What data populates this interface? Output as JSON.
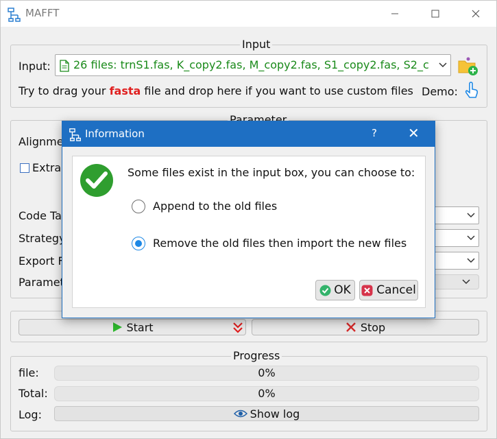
{
  "window": {
    "title": "MAFFT"
  },
  "input_group": {
    "title": "Input",
    "label": "Input:",
    "combo_value": "26 files: trnS1.fas, K_copy2.fas, M_copy2.fas, S1_copy2.fas, S2_c",
    "hint_pre": "Try to drag your",
    "hint_fasta": "fasta",
    "hint_post": "file and drop here if you want to use custom files",
    "demo_label": "Demo:"
  },
  "parameter_group": {
    "title": "Parameter",
    "alignment_label": "Alignme",
    "extract_label": "Extrac",
    "code_table_label": "Code Ta",
    "strategy_label": "Strategy",
    "export_label": "Export F",
    "parameters_label": "Paramet"
  },
  "run": {
    "start_label": "Start",
    "stop_label": "Stop"
  },
  "progress_group": {
    "title": "Progress",
    "file_label": "file:",
    "file_value": "0%",
    "total_label": "Total:",
    "total_value": "0%",
    "log_label": "Log:",
    "show_log_label": "Show log"
  },
  "dialog": {
    "title": "Information",
    "help_glyph": "?",
    "close_glyph": "✕",
    "message": "Some files exist in the input box, you can choose to:",
    "option_append": "Append to the old files",
    "option_remove": "Remove the old files then import the new files",
    "selected_option": "remove",
    "ok_label": "OK",
    "cancel_label": "Cancel"
  },
  "colors": {
    "accent": "#1e6fc3",
    "green": "#1a8a1a",
    "red": "#e02020",
    "radio": "#1e88e5"
  }
}
